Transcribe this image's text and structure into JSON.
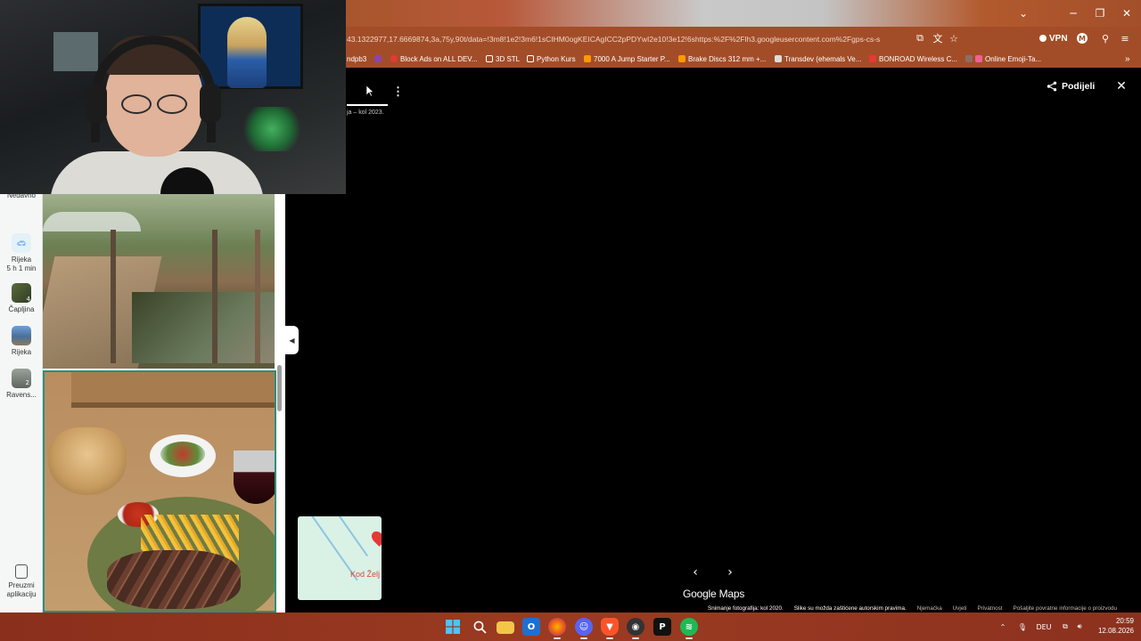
{
  "browser": {
    "url": "43.1322977,17.6669874,3a,75y,90t/data=!3m8!1e2!3m6!1sCIHM0ogKEICAgICC2pPDYwI2e10!3e12!6shttps:%2F%2Flh3.googleusercontent.com%2Fgps-cs-s",
    "vpn_label": "VPN",
    "profile_initial": "M",
    "bookmarks": [
      {
        "label": "ndpb3",
        "color": "#ffffff"
      },
      {
        "label": "",
        "color": "#8e44ad"
      },
      {
        "label": "Block Ads on ALL DEV...",
        "color": "#e53935"
      },
      {
        "label": "3D STL",
        "color": "#ffd54f"
      },
      {
        "label": "Python Kurs",
        "color": "#ffd54f"
      },
      {
        "label": "7000 A Jump Starter P...",
        "color": "#ff9800"
      },
      {
        "label": "Brake Discs 312 mm +...",
        "color": "#ff9800"
      },
      {
        "label": "Transdev (ehemals Ve...",
        "color": "#ffffff"
      },
      {
        "label": "BONROAD Wireless C...",
        "color": "#e53935"
      },
      {
        "label": "Online Emoji-Ta...",
        "color": "#8d6e63"
      }
    ]
  },
  "sidebar": {
    "recent_label": "Nedavno",
    "items": [
      {
        "label": "Rijeka",
        "sublabel": "5 h 1 min",
        "icon": "car-icon"
      },
      {
        "label": "Čapljina",
        "sublabel": "",
        "icon": "place-thumb"
      },
      {
        "label": "Rijeka",
        "sublabel": "",
        "icon": "place-thumb"
      },
      {
        "label": "Ravens...",
        "sublabel": "",
        "icon": "place-thumb"
      }
    ],
    "badges": [
      "4",
      "2"
    ],
    "download_label": "Preuzmi aplikaciju"
  },
  "viewer": {
    "date_label": "ja – kol 2023.",
    "share_label": "Podijeli",
    "close_icon": "✕",
    "prev_icon": "‹",
    "next_icon": "›",
    "logo": "Google Maps",
    "minimap_label": "Kod Želj",
    "footer": {
      "photo_date": "Snimanje fotografija: kol 2020.",
      "copyright": "Slike su možda zaštićene autorskim pravima.",
      "country": "Njemačka",
      "terms": "Uvjeti",
      "privacy": "Privatnost",
      "feedback": "Pošaljite povratne informacije o proizvodu"
    }
  },
  "taskbar": {
    "language": "DEU",
    "time": "20:59",
    "date": "12.08.2026"
  },
  "colors": {
    "chrome_accent": "#a34d28",
    "taskbar": "#9b3b22",
    "photo_border": "#2d8e7e"
  }
}
